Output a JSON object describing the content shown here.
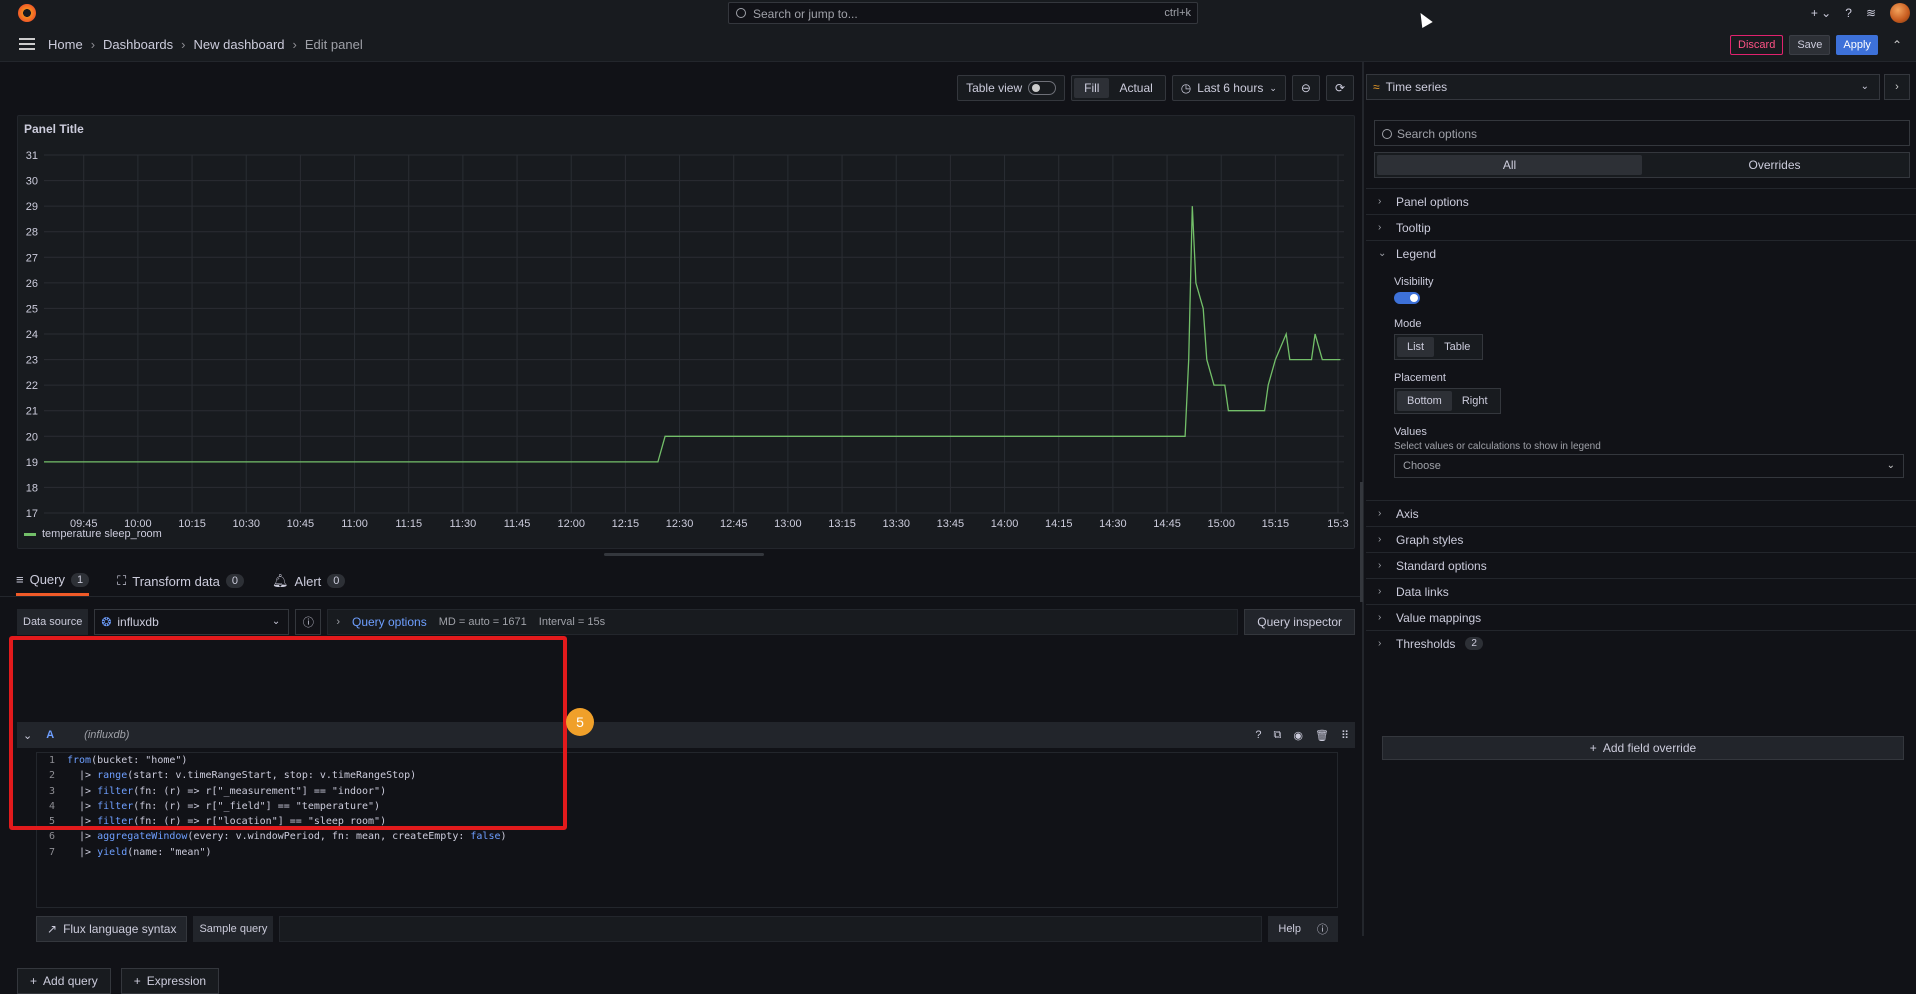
{
  "topbar": {
    "search_placeholder": "Search or jump to...",
    "shortcut": "ctrl+k",
    "plus": "+ ⌄"
  },
  "breadcrumb": [
    "Home",
    "Dashboards",
    "New dashboard",
    "Edit panel"
  ],
  "nav_buttons": {
    "discard": "Discard",
    "save": "Save",
    "apply": "Apply"
  },
  "toolbar": {
    "table_view": "Table view",
    "fill": "Fill",
    "actual": "Actual",
    "time_range": "Last 6 hours"
  },
  "panel": {
    "title": "Panel Title",
    "legend": "temperature sleep_room"
  },
  "chart_data": {
    "type": "line",
    "title": "Panel Title",
    "ylim": [
      17,
      31
    ],
    "y_ticks": [
      17,
      18,
      19,
      20,
      21,
      22,
      23,
      24,
      25,
      26,
      27,
      28,
      29,
      30,
      31
    ],
    "x_ticks": [
      "09:45",
      "10:00",
      "10:15",
      "10:30",
      "10:45",
      "11:00",
      "11:15",
      "11:30",
      "11:45",
      "12:00",
      "12:15",
      "12:30",
      "12:45",
      "13:00",
      "13:15",
      "13:30",
      "13:45",
      "14:00",
      "14:15",
      "14:30",
      "14:45",
      "15:00",
      "15:15",
      "15:3"
    ],
    "grid": true,
    "color": "#73bf69",
    "series": [
      {
        "name": "temperature sleep_room",
        "points": [
          [
            "09:34",
            19
          ],
          [
            "12:24",
            19
          ],
          [
            "12:26",
            20
          ],
          [
            "14:50",
            20
          ],
          [
            "14:51",
            23
          ],
          [
            "14:52",
            29
          ],
          [
            "14:53",
            26
          ],
          [
            "14:55",
            25
          ],
          [
            "14:56",
            23
          ],
          [
            "14:58",
            22
          ],
          [
            "15:01",
            22
          ],
          [
            "15:02",
            21
          ],
          [
            "15:12",
            21
          ],
          [
            "15:13",
            22
          ],
          [
            "15:15",
            23
          ],
          [
            "15:18",
            24
          ],
          [
            "15:19",
            23
          ],
          [
            "15:25",
            23
          ],
          [
            "15:26",
            24
          ],
          [
            "15:28",
            23
          ],
          [
            "15:33",
            23
          ]
        ]
      }
    ]
  },
  "query_tabs": [
    {
      "label": "Query",
      "count": "1"
    },
    {
      "label": "Transform data",
      "count": "0"
    },
    {
      "label": "Alert",
      "count": "0"
    }
  ],
  "datasource": {
    "label": "Data source",
    "value": "influxdb"
  },
  "query_options": {
    "label": "Query options",
    "md": "MD = auto = 1671",
    "interval": "Interval = 15s",
    "inspector": "Query inspector"
  },
  "query": {
    "ref": "A",
    "datasource": "(influxdb)"
  },
  "code_lines": [
    "from(bucket: \"home\")",
    "  |> range(start: v.timeRangeStart, stop: v.timeRangeStop)",
    "  |> filter(fn: (r) => r[\"_measurement\"] == \"indoor\")",
    "  |> filter(fn: (r) => r[\"_field\"] == \"temperature\")",
    "  |> filter(fn: (r) => r[\"location\"] == \"sleep_room\")",
    "  |> aggregateWindow(every: v.windowPeriod, fn: mean, createEmpty: false)",
    "  |> yield(name: \"mean\")"
  ],
  "annotation_badge": "5",
  "flux_bar": {
    "syntax": "Flux language syntax",
    "sample": "Sample query",
    "help": "Help"
  },
  "add_buttons": {
    "query": "Add query",
    "expression": "Expression"
  },
  "options": {
    "viz": "Time series",
    "search_placeholder": "Search options",
    "tab_all": "All",
    "tab_overrides": "Overrides",
    "panel_options": "Panel options",
    "tooltip": "Tooltip",
    "legend": "Legend",
    "visibility": "Visibility",
    "mode": "Mode",
    "mode_list": "List",
    "mode_table": "Table",
    "placement": "Placement",
    "placement_bottom": "Bottom",
    "placement_right": "Right",
    "values": "Values",
    "values_desc": "Select values or calculations to show in legend",
    "values_choose": "Choose",
    "axis": "Axis",
    "graph_styles": "Graph styles",
    "standard_options": "Standard options",
    "data_links": "Data links",
    "value_mappings": "Value mappings",
    "thresholds": "Thresholds",
    "thresholds_count": "2",
    "add_override": "Add field override"
  }
}
